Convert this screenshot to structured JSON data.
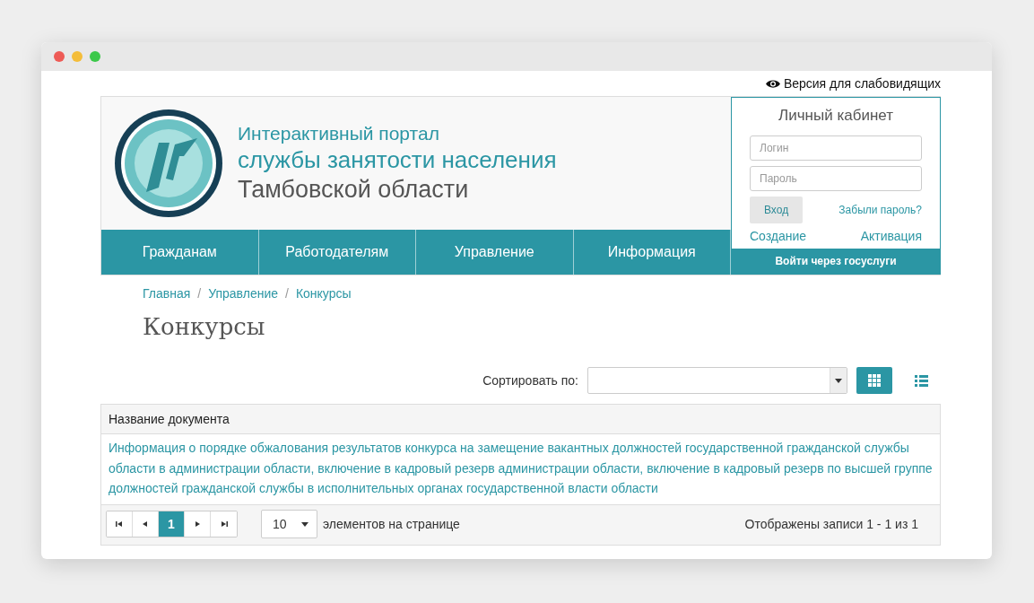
{
  "accessibility_link": "Версия для слабовидящих",
  "header": {
    "title_lines": [
      "Интерактивный портал",
      "службы занятости населения",
      "Тамбовской области"
    ]
  },
  "nav": [
    {
      "label": "Гражданам"
    },
    {
      "label": "Работодателям"
    },
    {
      "label": "Управление"
    },
    {
      "label": "Информация"
    }
  ],
  "login": {
    "title": "Личный кабинет",
    "login_placeholder": "Логин",
    "password_placeholder": "Пароль",
    "submit": "Вход",
    "forgot": "Забыли пароль?",
    "create": "Создание",
    "activate": "Активация",
    "gosuslugi": "Войти через госуслуги"
  },
  "breadcrumbs": [
    {
      "kind": "link",
      "text": "Главная"
    },
    {
      "kind": "separator",
      "text": "/"
    },
    {
      "kind": "link",
      "text": "Управление"
    },
    {
      "kind": "separator",
      "text": "/"
    },
    {
      "kind": "link",
      "text": "Конкурсы"
    }
  ],
  "page_title": "Конкурсы",
  "sort": {
    "label": "Сортировать по:"
  },
  "views": [
    {
      "kind": "grid",
      "selected": true
    },
    {
      "kind": "list",
      "selected": false
    }
  ],
  "table": {
    "columns": [
      "Название документа"
    ],
    "rows": [
      "Информация о порядке обжалования результатов конкурса на замещение вакантных должностей государственной гражданской службы области в администрации области, включение в кадровый резерв администрации области, включение в кадровый резерв по высшей группе должностей гражданской службы в исполнительных органах государственной власти области"
    ]
  },
  "pager": {
    "pages": [
      {
        "label": "1",
        "selected": true
      }
    ],
    "page_size": "10",
    "page_size_label": "элементов на странице",
    "summary": "Отображены записи 1 - 1 из 1"
  }
}
